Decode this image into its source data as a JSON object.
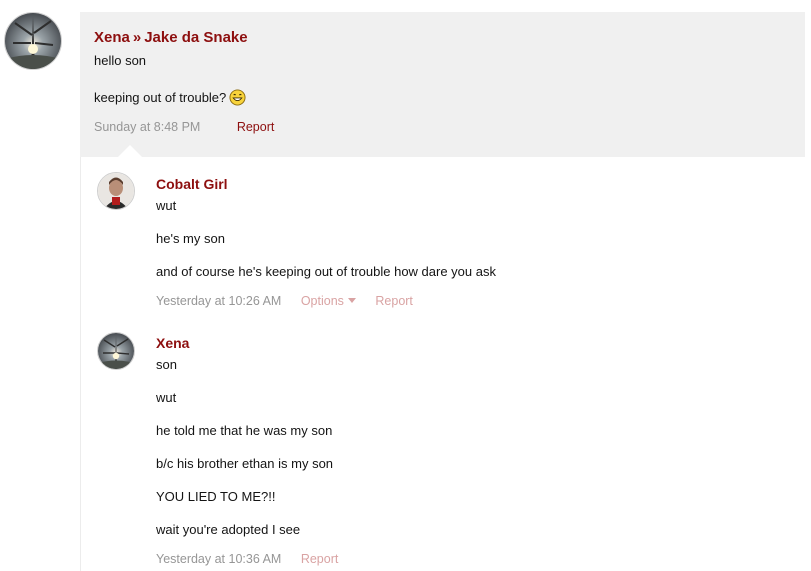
{
  "status": {
    "author": "Xena",
    "separator": "»",
    "target": "Jake da Snake",
    "lines": [
      "hello son",
      "keeping out of trouble?"
    ],
    "emoji": "grin-smiley-icon",
    "timestamp": "Sunday at 8:48 PM",
    "report_label": "Report"
  },
  "comments": [
    {
      "author": "Cobalt Girl",
      "lines": [
        "wut",
        "he's my son",
        "and of course he's keeping out of trouble how dare you ask"
      ],
      "timestamp": "Yesterday at 10:26 AM",
      "options_label": "Options",
      "report_label": "Report"
    },
    {
      "author": "Xena",
      "lines": [
        "son",
        "wut",
        "he told me that he was my son",
        "b/c his brother ethan is my son",
        "YOU LIED TO ME?!!",
        "wait you're adopted I see"
      ],
      "timestamp": "Yesterday at 10:36 AM",
      "report_label": "Report"
    }
  ],
  "colors": {
    "accent": "#8d0f0f",
    "muted_link": "#d9a3a3",
    "timestamp": "#969696",
    "status_background": "#f0f0f0"
  }
}
